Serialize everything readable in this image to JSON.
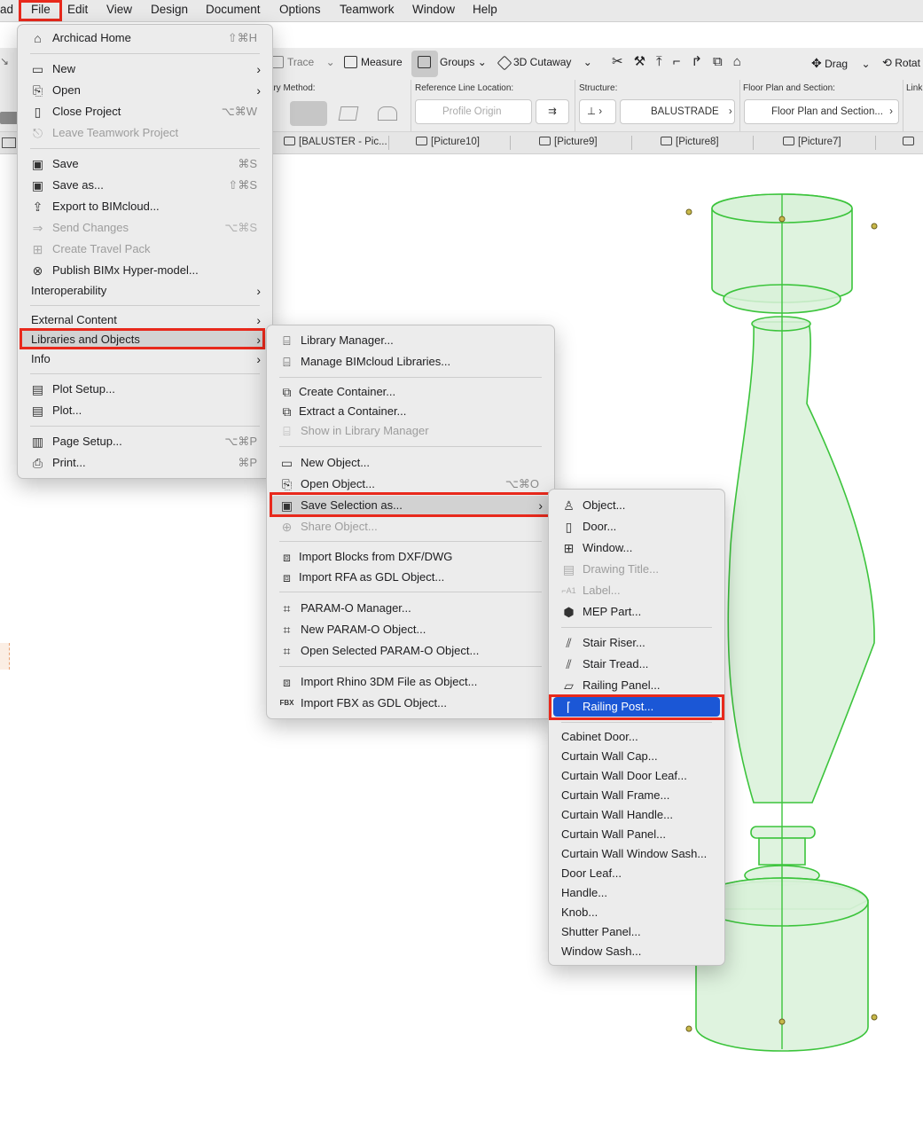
{
  "menubar": {
    "app_fragment": "ad",
    "items": [
      "File",
      "Edit",
      "View",
      "Design",
      "Document",
      "Options",
      "Teamwork",
      "Window",
      "Help"
    ]
  },
  "toolbar": {
    "trace": "Trace",
    "measure": "Measure",
    "groups": "Groups",
    "cutaway": "3D Cutaway",
    "drag": "Drag",
    "rotate": "Rotat"
  },
  "infobox": {
    "geometry_label": "etry Method:",
    "refline_label": "Reference Line Location:",
    "refline_value": "Profile Origin",
    "structure_label": "Structure:",
    "structure_value": "BALUSTRADE",
    "floorplan_label": "Floor Plan and Section:",
    "floorplan_value": "Floor Plan and Section...",
    "link_label": "Link"
  },
  "tabs": [
    "[BALUSTER - Pic...",
    "[Picture10]",
    "[Picture9]",
    "[Picture8]",
    "[Picture7]"
  ],
  "file_menu": [
    {
      "label": "Archicad Home",
      "shortcut": "⇧⌘H",
      "icon": "home-icon"
    },
    {
      "label": "New",
      "submenu": true,
      "icon": "new-file-icon"
    },
    {
      "label": "Open",
      "submenu": true,
      "icon": "open-folder-icon"
    },
    {
      "label": "Close Project",
      "shortcut": "⌥⌘W",
      "icon": "close-project-icon"
    },
    {
      "label": "Leave Teamwork Project",
      "disabled": true,
      "icon": "leave-teamwork-icon"
    },
    {
      "label": "Save",
      "shortcut": "⌘S",
      "icon": "save-icon"
    },
    {
      "label": "Save as...",
      "shortcut": "⇧⌘S",
      "icon": "save-as-icon"
    },
    {
      "label": "Export to BIMcloud...",
      "icon": "export-bimcloud-icon"
    },
    {
      "label": "Send Changes",
      "shortcut": "⌥⌘S",
      "disabled": true,
      "icon": "send-changes-icon"
    },
    {
      "label": "Create Travel Pack",
      "disabled": true,
      "icon": "travel-pack-icon"
    },
    {
      "label": "Publish BIMx Hyper-model...",
      "icon": "bimx-icon"
    },
    {
      "label": "Interoperability",
      "submenu": true
    },
    {
      "label": "External Content",
      "submenu": true
    },
    {
      "label": "Libraries and Objects",
      "submenu": true
    },
    {
      "label": "Info",
      "submenu": true
    },
    {
      "label": "Plot Setup...",
      "icon": "plot-setup-icon"
    },
    {
      "label": "Plot...",
      "icon": "plot-icon"
    },
    {
      "label": "Page Setup...",
      "shortcut": "⌥⌘P",
      "icon": "page-setup-icon"
    },
    {
      "label": "Print...",
      "shortcut": "⌘P",
      "icon": "print-icon"
    }
  ],
  "libraries_menu": [
    {
      "label": "Library Manager...",
      "icon": "library-manager-icon"
    },
    {
      "label": "Manage BIMcloud Libraries...",
      "icon": "bimcloud-library-icon"
    },
    {
      "label": "Create Container...",
      "icon": "create-container-icon"
    },
    {
      "label": "Extract a Container...",
      "icon": "extract-container-icon"
    },
    {
      "label": "Show in Library Manager",
      "disabled": true,
      "icon": "show-library-icon"
    },
    {
      "label": "New Object...",
      "icon": "new-object-icon"
    },
    {
      "label": "Open Object...",
      "shortcut": "⌥⌘O",
      "icon": "open-object-icon"
    },
    {
      "label": "Save Selection as...",
      "submenu": true,
      "icon": "save-selection-icon"
    },
    {
      "label": "Share Object...",
      "disabled": true,
      "icon": "share-object-icon"
    },
    {
      "label": "Import Blocks from DXF/DWG",
      "icon": "import-dxf-icon"
    },
    {
      "label": "Import RFA as GDL Object...",
      "icon": "import-rfa-icon"
    },
    {
      "label": "PARAM-O Manager...",
      "icon": "paramo-manager-icon"
    },
    {
      "label": "New PARAM-O Object...",
      "icon": "new-paramo-icon"
    },
    {
      "label": "Open Selected PARAM-O Object...",
      "icon": "open-paramo-icon"
    },
    {
      "label": "Import Rhino 3DM File as Object...",
      "icon": "import-rhino-icon"
    },
    {
      "label": "Import FBX as GDL Object...",
      "icon": "import-fbx-icon"
    }
  ],
  "save_selection_menu": [
    {
      "label": "Object...",
      "icon": "object-icon"
    },
    {
      "label": "Door...",
      "icon": "door-icon"
    },
    {
      "label": "Window...",
      "icon": "window-icon"
    },
    {
      "label": "Drawing Title...",
      "disabled": true,
      "icon": "drawing-title-icon"
    },
    {
      "label": "Label...",
      "disabled": true,
      "icon": "label-icon"
    },
    {
      "label": "MEP Part...",
      "icon": "mep-part-icon"
    },
    {
      "label": "Stair Riser...",
      "icon": "stair-riser-icon"
    },
    {
      "label": "Stair Tread...",
      "icon": "stair-tread-icon"
    },
    {
      "label": "Railing Panel...",
      "icon": "railing-panel-icon"
    },
    {
      "label": "Railing Post...",
      "icon": "railing-post-icon"
    },
    {
      "label": "Cabinet Door..."
    },
    {
      "label": "Curtain Wall Cap..."
    },
    {
      "label": "Curtain Wall Door Leaf..."
    },
    {
      "label": "Curtain Wall Frame..."
    },
    {
      "label": "Curtain Wall Handle..."
    },
    {
      "label": "Curtain Wall Panel..."
    },
    {
      "label": "Curtain Wall Window Sash..."
    },
    {
      "label": "Door Leaf..."
    },
    {
      "label": "Handle..."
    },
    {
      "label": "Knob..."
    },
    {
      "label": "Shutter Panel..."
    },
    {
      "label": "Window Sash..."
    }
  ],
  "colors": {
    "highlight_outline": "#e8291c",
    "selection_blue": "#1b57d6",
    "model_green": "#3cc43c",
    "model_fill": "#d8f0d8"
  }
}
